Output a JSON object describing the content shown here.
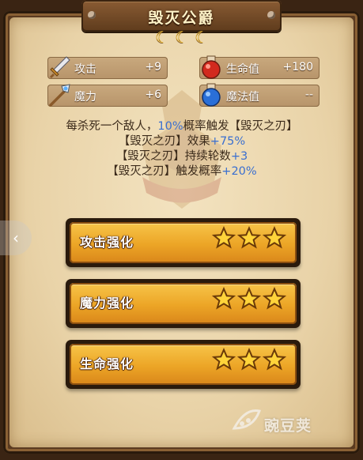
{
  "title": "毁灭公爵",
  "moons": [
    "☾",
    "☾",
    "☾"
  ],
  "stats": {
    "attack": {
      "label": "攻击",
      "value": "+9",
      "icon": "sword-icon"
    },
    "hp": {
      "label": "生命值",
      "value": "+180",
      "icon": "red-potion-icon"
    },
    "magic": {
      "label": "魔力",
      "value": "+6",
      "icon": "staff-icon"
    },
    "mana": {
      "label": "魔法值",
      "value": "--",
      "icon": "blue-potion-icon"
    }
  },
  "description": {
    "line1_a": "每杀死一个敌人，",
    "line1_hl": "10%",
    "line1_b": "概率触发【毁灭之刃】",
    "line2_a": "【毁灭之刃】效果",
    "line2_hl": "+75%",
    "line3_a": "【毁灭之刃】持续轮数",
    "line3_hl": "+3",
    "line4_a": "【毁灭之刃】触发概率",
    "line4_hl": "+20%"
  },
  "buttons": [
    {
      "label": "攻击强化",
      "stars": 3
    },
    {
      "label": "魔力强化",
      "stars": 3
    },
    {
      "label": "生命强化",
      "stars": 3
    }
  ],
  "watermark": {
    "text": "豌豆荚"
  },
  "colors": {
    "accent_orange": "#eca526",
    "highlight_blue": "#3a6fd0",
    "parchment": "#e9d3a8"
  }
}
